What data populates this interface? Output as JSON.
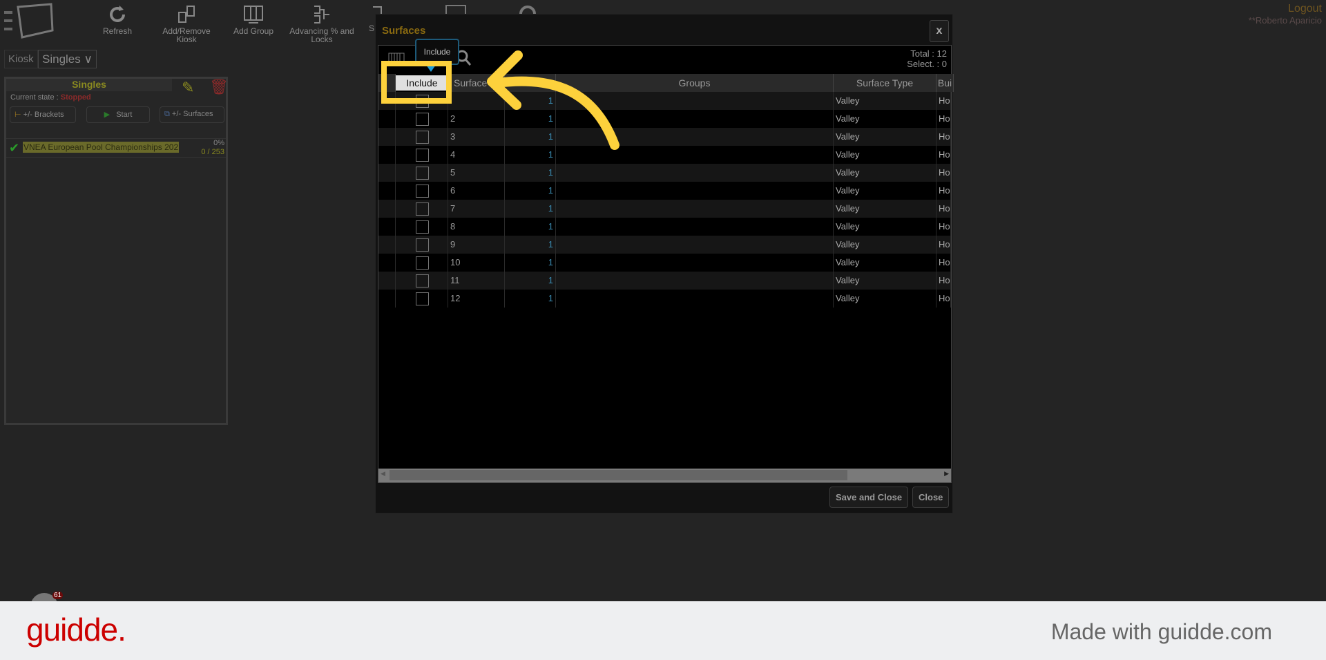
{
  "toolbar": {
    "items": [
      {
        "label": "Refresh",
        "icon": "refresh-icon"
      },
      {
        "label": "Add/Remove Kiosk",
        "icon": "add-remove-kiosk-icon"
      },
      {
        "label": "Add Group",
        "icon": "add-group-icon"
      },
      {
        "label": "Advancing % and Locks",
        "icon": "bracket-icon"
      },
      {
        "label": "S",
        "icon": "partial-icon"
      }
    ]
  },
  "user": {
    "logout": "Logout",
    "name": "**Roberto Aparicio"
  },
  "kiosk": {
    "label": "Kiosk",
    "selected": "Singles"
  },
  "panel": {
    "title": "Singles",
    "state_label": "Current state :",
    "state_value": "Stopped",
    "brackets_btn": "+/- Brackets",
    "start_btn": "Start",
    "surfaces_btn": "+/- Surfaces",
    "event": {
      "name": "VNEA European Pool Championships 202",
      "percent": "0%",
      "progress": "0 / 253"
    }
  },
  "dialog": {
    "title": "Surfaces",
    "close_x": "x",
    "tooltip": "Include",
    "total": "Total : 12",
    "selected": "Select. : 0",
    "columns": [
      "Include",
      "Surface",
      "",
      "Groups",
      "Surface Type",
      "Bui"
    ],
    "rows": [
      {
        "n": "",
        "v": "1",
        "type": "Valley",
        "b": "Ho"
      },
      {
        "n": "2",
        "v": "1",
        "type": "Valley",
        "b": "Ho"
      },
      {
        "n": "3",
        "v": "1",
        "type": "Valley",
        "b": "Ho"
      },
      {
        "n": "4",
        "v": "1",
        "type": "Valley",
        "b": "Ho"
      },
      {
        "n": "5",
        "v": "1",
        "type": "Valley",
        "b": "Ho"
      },
      {
        "n": "6",
        "v": "1",
        "type": "Valley",
        "b": "Ho"
      },
      {
        "n": "7",
        "v": "1",
        "type": "Valley",
        "b": "Ho"
      },
      {
        "n": "8",
        "v": "1",
        "type": "Valley",
        "b": "Ho"
      },
      {
        "n": "9",
        "v": "1",
        "type": "Valley",
        "b": "Ho"
      },
      {
        "n": "10",
        "v": "1",
        "type": "Valley",
        "b": "Ho"
      },
      {
        "n": "11",
        "v": "1",
        "type": "Valley",
        "b": "Ho"
      },
      {
        "n": "12",
        "v": "1",
        "type": "Valley",
        "b": "Ho"
      }
    ],
    "save_close": "Save and Close",
    "close": "Close",
    "horizontal_scroll_fraction": 0.8
  },
  "badge": "61",
  "footer": {
    "logo": "guidde.",
    "tagline": "Made with guidde.com"
  },
  "colors": {
    "accent": "#8a7a12",
    "stopped": "#8b2a2a",
    "highlight": "#fdd13c",
    "logo": "#cc0000"
  }
}
